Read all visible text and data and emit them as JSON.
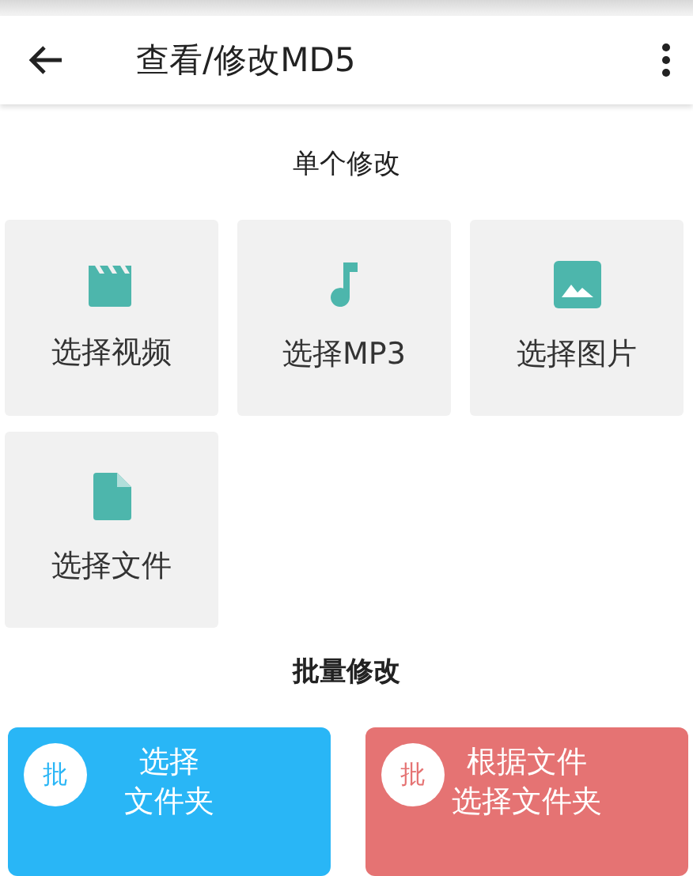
{
  "toolbar": {
    "title": "查看/修改MD5"
  },
  "single_section": {
    "title": "单个修改",
    "tiles": [
      {
        "kind": "video",
        "label": "选择视频"
      },
      {
        "kind": "music",
        "label": "选择MP3"
      },
      {
        "kind": "image",
        "label": "选择图片"
      },
      {
        "kind": "file",
        "label": "选择文件"
      }
    ]
  },
  "batch_section": {
    "title": "批量修改",
    "cards": [
      {
        "badge": "批",
        "lines": [
          "选择",
          "文件夹"
        ],
        "color": "#29b6f6"
      },
      {
        "badge": "批",
        "lines": [
          "根据文件",
          "选择文件夹"
        ],
        "color": "#e57373"
      }
    ]
  }
}
